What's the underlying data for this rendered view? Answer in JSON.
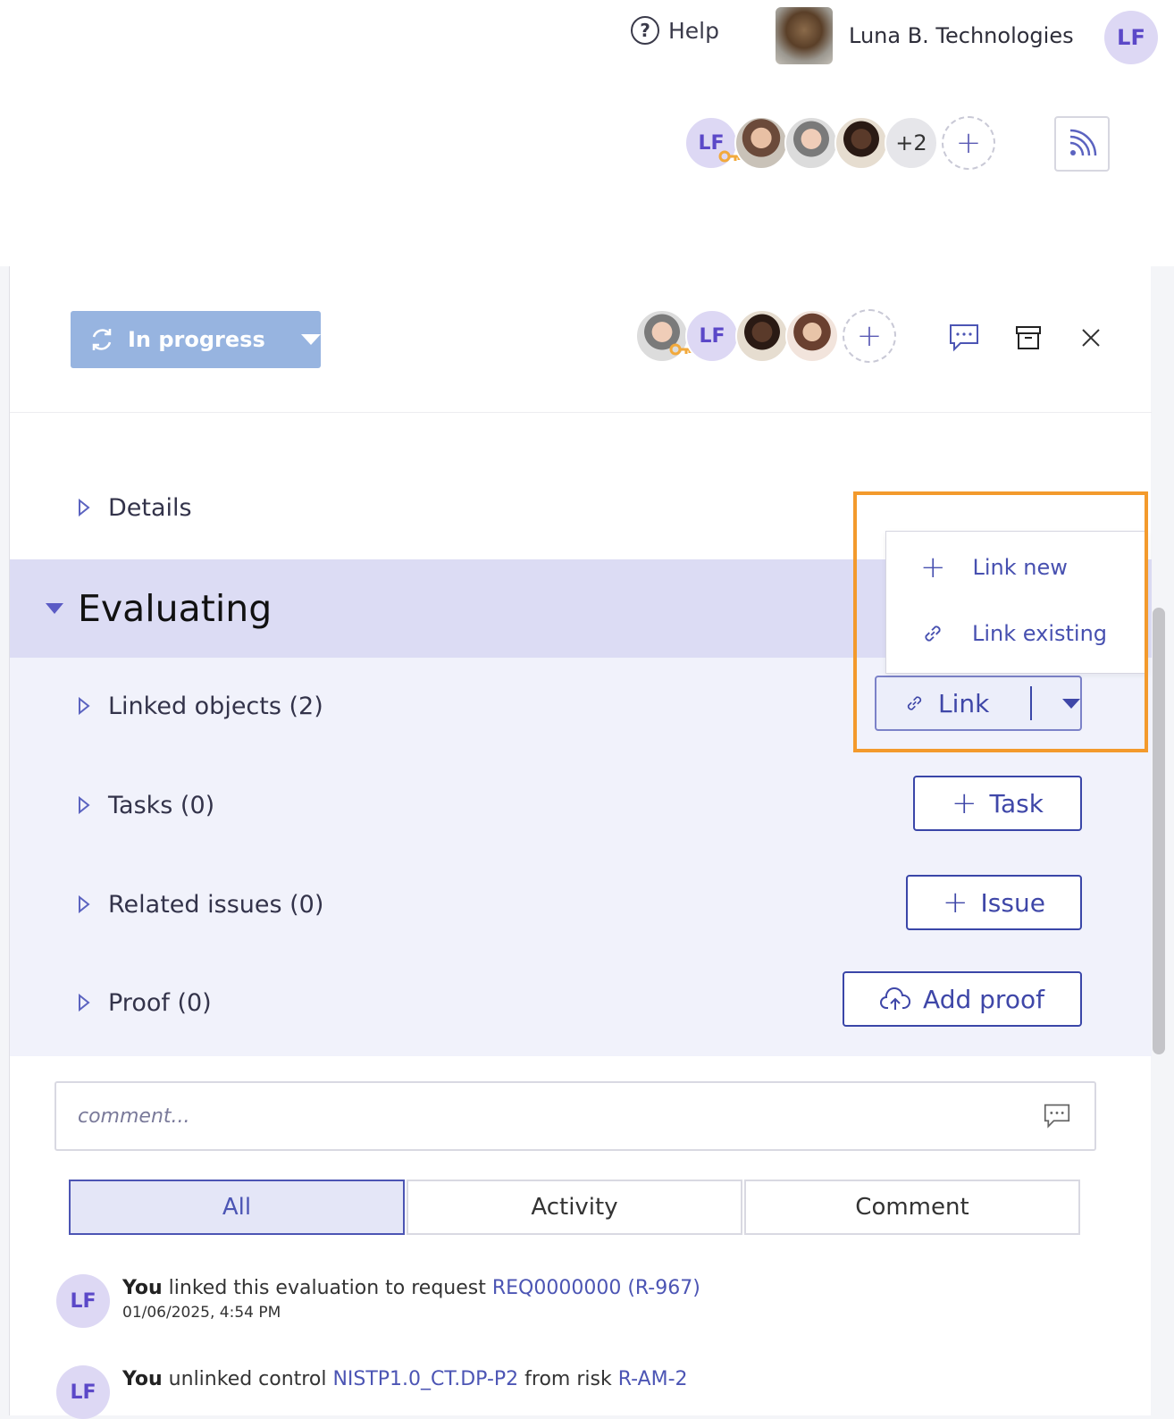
{
  "topbar": {
    "help_label": "Help",
    "org_name": "Luna B. Technologies",
    "user_initials": "LF"
  },
  "upper": {
    "owner_initials": "LF",
    "more_count": "+2"
  },
  "panel": {
    "status_label": "In progress",
    "assignee_initials": "LF"
  },
  "sections": {
    "details": "Details",
    "evaluating": "Evaluating",
    "linked_objects": "Linked objects (2)",
    "tasks": "Tasks (0)",
    "related_issues": "Related issues (0)",
    "proof": "Proof (0)"
  },
  "buttons": {
    "link": "Link",
    "task": "Task",
    "issue": "Issue",
    "add_proof": "Add proof"
  },
  "link_menu": {
    "link_new": "Link new",
    "link_existing": "Link existing"
  },
  "comment": {
    "placeholder": "comment..."
  },
  "tabs": [
    "All",
    "Activity",
    "Comment"
  ],
  "feed": [
    {
      "initials": "LF",
      "actor": "You",
      "text1": " linked this evaluation to request ",
      "link1": "REQ0000000 (R-967)",
      "timestamp": "01/06/2025, 4:54 PM"
    },
    {
      "initials": "LF",
      "actor": "You",
      "text1": " unlinked control ",
      "link1": "NISTP1.0_CT.DP-P2",
      "text2": " from risk ",
      "link2": "R-AM-2"
    }
  ],
  "colors": {
    "accent": "#3f47a8",
    "status": "#97b4e0",
    "highlight": "#f39a2c",
    "section_bg": "#dcdcf4"
  }
}
